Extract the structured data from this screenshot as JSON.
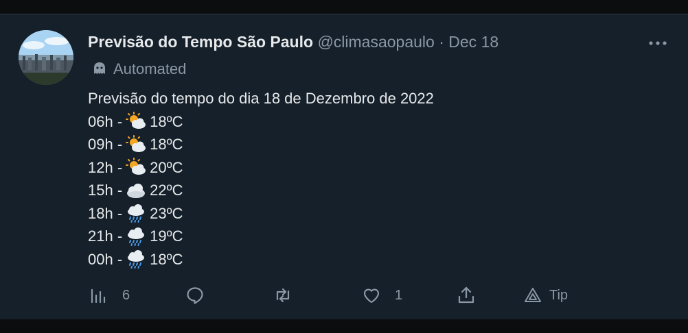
{
  "tweet": {
    "display_name": "Previsão do Tempo São Paulo",
    "handle": "@climasaopaulo",
    "separator": "·",
    "date": "Dec 18",
    "automated_label": "Automated",
    "title_line": "Previsão do tempo do dia 18 de Dezembro de 2022",
    "forecast": [
      {
        "hour": "06h -",
        "icon": "sun-behind-cloud-icon",
        "temp": "18ºC"
      },
      {
        "hour": "09h -",
        "icon": "sun-behind-cloud-icon",
        "temp": "18ºC"
      },
      {
        "hour": "12h -",
        "icon": "sun-behind-cloud-icon",
        "temp": "20ºC"
      },
      {
        "hour": "15h -",
        "icon": "cloud-icon",
        "temp": "22ºC"
      },
      {
        "hour": "18h -",
        "icon": "cloud-with-rain-icon",
        "temp": "23ºC"
      },
      {
        "hour": "21h -",
        "icon": "cloud-with-rain-icon",
        "temp": "19ºC"
      },
      {
        "hour": "00h -",
        "icon": "cloud-with-rain-icon",
        "temp": "18ºC"
      }
    ]
  },
  "actions": {
    "views_count": "6",
    "likes_count": "1",
    "tip_label": "Tip"
  },
  "colors": {
    "background": "#15202b",
    "text": "#e7e9ea",
    "muted": "#8b98a5"
  }
}
